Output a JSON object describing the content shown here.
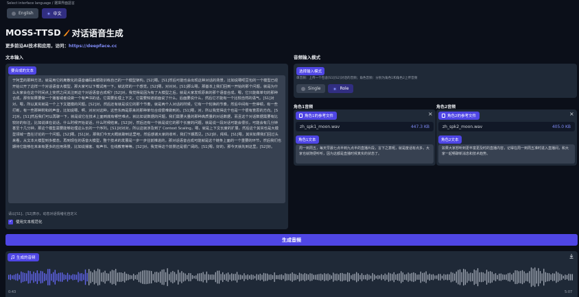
{
  "lang": {
    "label": "Select interface language / 選擇界面語言",
    "options": [
      {
        "label": "English",
        "selected": false
      },
      {
        "label": "中文",
        "selected": true
      }
    ]
  },
  "header": {
    "title": "MOSS-TTSD",
    "title_icon": "feather-icon",
    "subtitle": "对话语音生成",
    "promo_text": "更多前沿AI技术和应用，访问：",
    "promo_link": "https://deepface.cc"
  },
  "left": {
    "section_title": "文本输入",
    "text_label": "要合成的文本",
    "text_value": "于阿里的那种方法，就是用它的离散化的语音编码来帮助训练自己的一个模型架构。[S2]嗯。[S1]然后可能也会出现这种对话的场景，比如说嗯呃豆包的一个模型已经开始公开了这样一个对话语音大模型，那大家可以下载试用一下，就这样的一个感觉。[S2]嗯，对对对。[S1]那么嗯，那基本上我们回到一开始的那个问题，就是为什么大家会在这个时间点上突然之间关注到这个对话语音合成呢？[S2]对，我觉得是因为有了大模型之后，就是大家发现原来的那个语音合成，嗯，它只能做单句的那种合成，那你如果要做一个播客或者说做一个有声书的话，它需要处理上下文，它需要知道前面说了什么，后面要说什么，然后它才能有一个比较自然的语气。[S1]对对，嗯，所以其实就是一个上下文建模的问题。[S2]对，然后还有就是说它的那个节奏，就是两个人对话的时候，它有一个轮换的节奏，然后中间有一些停顿，有一些打断，有一些那种附和的声音，比如说嗯、啊、对对对这种，这些东西是原来的那种单句合成很难做到的。[S1]嗯，对，所以我觉得这个也是一个很有意思的方向。[S2]对。[S1]然后我们可以再聊一下，就是说它在技术上面到底有哪些难点，就比如说数据的问题，我们需要大量的那种高质量的对话数据，而且这个对话数据需要有比较好的标注，比如说谁在说话，什么时候开始说话，什么时候结束。[S2]对，然后还有一个就是说它的那个长度的问题，就是说一段对话可能会很长，可能会有几分钟甚至十几分钟，那这个模型需要能够处理这么长的一个序列。[S1]对对对，所以这就涉及到了 Context Scaling，嗯，就是上下文长度的扩展，然后这个其实也是大模型领域一直在讨论的一个问题。[S2]嗯。[S1]对，那我们今天大概就聊到这里吧，然后感谢大家的收听，我们下期再见。[S2]好，拜拜。[S1]嗯，其实如果我们回过头来看，从文本大模型到多模态，再到现在的语音大模型，整个技术的发展是一步一步往前推进的，那对话语音合成可能就是这个链条上面的一个重要的环节，然后我们也期待它能够在未来有更多的应用场景，比如说播客、有声书、在线教育等等。[S2]对，我觉得这个前景还是很广阔的。[S1]嗯，好的，那今天就先到这里。[S2]好。",
    "hint": "请以[S1]、[S2]表示，动态对话情绪化自定义",
    "checkbox_label": "使用文本规范化",
    "checkbox_checked": true
  },
  "right": {
    "section_title": "音频输入模式",
    "mode_label": "选择输入模式",
    "mode_hint": "单音频：上传一个包含[S1][S2]对话的音频；角色音频：分别为角色1和角色2上传音频",
    "modes": [
      {
        "label": "Single",
        "selected": false
      },
      {
        "label": "Role",
        "selected": true
      }
    ],
    "role1": {
      "title": "角色1音频",
      "chip": "角色1的参考文件",
      "filename": "zh_spk1_moon.wav",
      "filesize": "447.3 KB",
      "text_label": "角色1文本",
      "text_value": "周一到周五，每天早晨七点半到九点半的直播片段，言下之意呢，就是废话有点多，大家也就随便听听，因为这都是直播时候真实的状态了。"
    },
    "role2": {
      "title": "角色2音频",
      "chip": "角色2的参考文件",
      "filename": "zh_spk2_moon.wav",
      "filesize": "405.0 KB",
      "text_label": "角色2文本",
      "text_value": "如果大家想听到更丰富更及时的直播内容，记得在周一到周五准时进入直播间，和大家一起畅聊新消息和技术趋势。"
    }
  },
  "generate_button": "生成音频",
  "output": {
    "label": "生成的音频",
    "time_start": "0:43",
    "time_end": "5:07",
    "progress": 0.14
  },
  "colors": {
    "background": "#0b0f19",
    "panel": "#1f2937",
    "accent": "#4f46e5",
    "link": "#818cf8"
  }
}
